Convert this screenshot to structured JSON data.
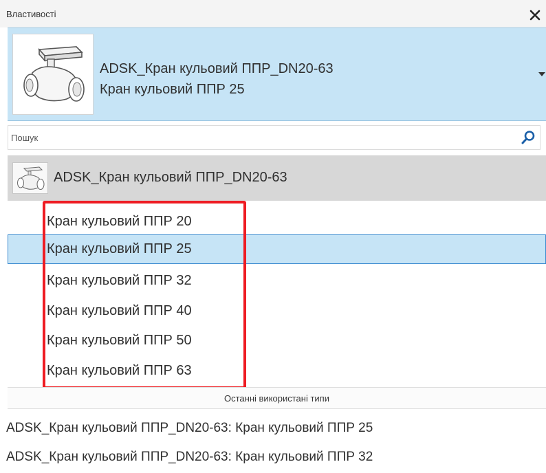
{
  "window": {
    "title": "Властивості",
    "close_icon": "close-icon"
  },
  "type_selector": {
    "family_name": "ADSK_Кран кульовий ППР_DN20-63",
    "type_name": "Кран кульовий ППР 25",
    "thumbnail_icon": "ball-valve-icon",
    "dropdown_icon": "caret-down-icon"
  },
  "search": {
    "placeholder": "Пошук",
    "value": "",
    "icon": "search-icon"
  },
  "family_group": {
    "label": "ADSK_Кран кульовий ППР_DN20-63",
    "icon": "ball-valve-icon"
  },
  "types": [
    {
      "label": "Кран кульовий ППР 20",
      "selected": false
    },
    {
      "label": "Кран кульовий ППР 25",
      "selected": true
    },
    {
      "label": "Кран кульовий ППР 32",
      "selected": false
    },
    {
      "label": "Кран кульовий ППР 40",
      "selected": false
    },
    {
      "label": "Кран кульовий ППР 50",
      "selected": false
    },
    {
      "label": "Кран кульовий ППР 63",
      "selected": false
    }
  ],
  "recent": {
    "header": "Останні використані типи",
    "items": [
      {
        "label": "ADSK_Кран кульовий ППР_DN20-63: Кран кульовий ППР 25"
      },
      {
        "label": "ADSK_Кран кульовий ППР_DN20-63: Кран кульовий ППР 32"
      }
    ]
  },
  "colors": {
    "selection_bg": "#c6e4f6",
    "selection_border": "#3b8bd0",
    "group_bg": "#d7d7d7",
    "annotation_red": "#ee1c23",
    "search_icon": "#1a5fa8"
  }
}
